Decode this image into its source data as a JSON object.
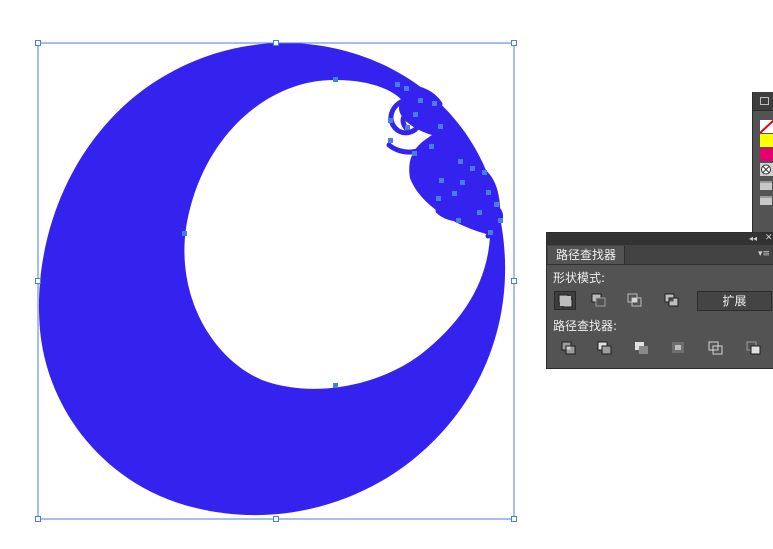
{
  "pathfinder": {
    "tab_label": "路径查找器",
    "shape_modes_label": "形状模式:",
    "pathfinders_label": "路径查找器:",
    "expand_label": "扩展",
    "collapse_glyph": "◂◂",
    "close_glyph": "✕",
    "menu_glyph": "▾≡",
    "shape_mode_buttons": [
      "unite-icon",
      "minus-front-icon",
      "intersect-icon",
      "exclude-icon"
    ],
    "pathfinder_buttons": [
      "divide-icon",
      "trim-icon",
      "merge-icon",
      "crop-icon",
      "outline-icon",
      "minus-back-icon"
    ]
  },
  "artwork": {
    "fill_color": "#3422ee",
    "selection_color": "#4a7de2"
  },
  "swatches": {
    "colors": [
      "none",
      "#ffff00",
      "#e4006e",
      "registration"
    ]
  }
}
